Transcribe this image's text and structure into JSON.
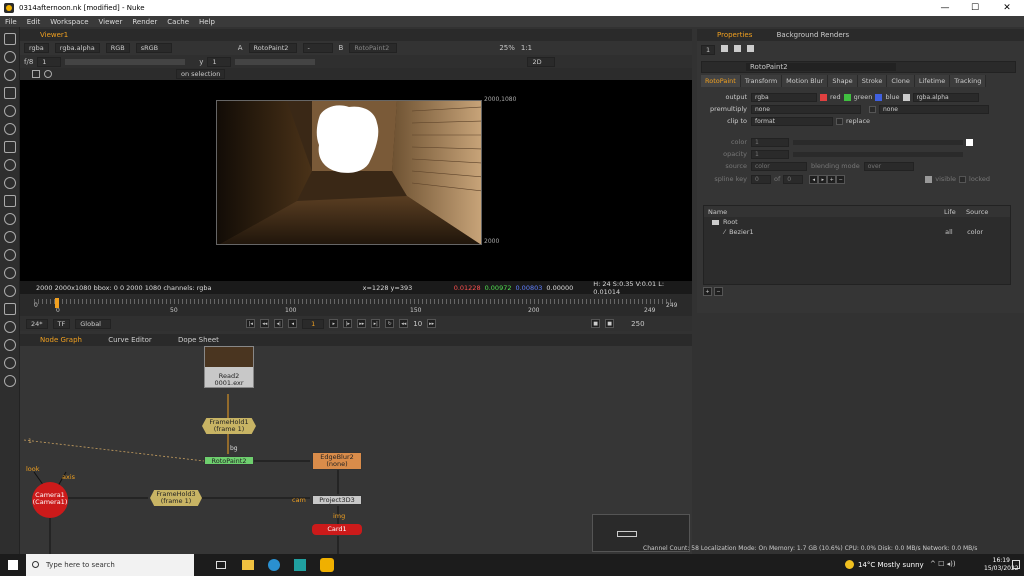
{
  "window": {
    "title": "0314afternoon.nk [modified] - Nuke",
    "controls": [
      "—",
      "☐",
      "✕"
    ]
  },
  "menu": [
    "File",
    "Edit",
    "Workspace",
    "Viewer",
    "Render",
    "Cache",
    "Help"
  ],
  "viewer": {
    "tab": "Viewer1",
    "channels": "rgba",
    "alpha": "rgba.alpha",
    "colorspace": "RGB",
    "lut": "sRGB",
    "input_a_label": "A",
    "input_a": "RotoPaint2",
    "input_b_label": "B",
    "input_b": "RotoPaint2",
    "zoom": "25%",
    "ratio": "1:1",
    "mode": "2D",
    "frame_field": "f/8",
    "gain": "1",
    "gamma_label": "y",
    "gamma": "1",
    "on_selection": "on selection",
    "format_label_tr": "2000,1080",
    "format_label_br": "2000",
    "status_left": "2000 2000x1080  bbox: 0 0 2000 1080 channels: rgba",
    "cursor": "x=1228 y=393",
    "r": "0.01228",
    "g": "0.00972",
    "b": "0.00803",
    "a": "0.00000",
    "hsv": "H: 24 S:0.35 V:0.01  L: 0.01014"
  },
  "timeline": {
    "ticks": [
      "0",
      "50",
      "100",
      "150",
      "200",
      "249"
    ],
    "start": "0",
    "end": "249",
    "fps": "24*",
    "tf": "TF",
    "global": "Global",
    "current_frame": "1",
    "increment": "10",
    "end_frame": "250"
  },
  "nodegraph": {
    "tabs": [
      "Node Graph",
      "Curve Editor",
      "Dope Sheet"
    ],
    "nodes": {
      "read2": {
        "name": "Read2",
        "file": "0001.exr"
      },
      "framehold1": {
        "name": "FrameHold1",
        "sub": "(frame 1)"
      },
      "rotopaint2": {
        "name": "RotoPaint2"
      },
      "edgeblur2": {
        "name": "EdgeBlur2",
        "sub": "(none)"
      },
      "camera1": {
        "name": "Camera1",
        "sub": "(Camera1)"
      },
      "framehold3": {
        "name": "FrameHold3",
        "sub": "(frame 1)"
      },
      "project3d3": {
        "name": "Project3D3"
      },
      "card1": {
        "name": "Card1"
      }
    },
    "edge_labels": {
      "look": "look",
      "axis": "axis",
      "cam": "cam",
      "img": "img",
      "bg": "bg",
      "one": "1"
    }
  },
  "properties": {
    "tabs": [
      "Properties",
      "Background Renders"
    ],
    "node_name": "RotoPaint2",
    "subtabs": [
      "RotoPaint",
      "Transform",
      "Motion Blur",
      "Shape",
      "Stroke",
      "Clone",
      "Lifetime",
      "Tracking"
    ],
    "output_label": "output",
    "output": "rgba",
    "channels": [
      "red",
      "green",
      "blue",
      "rgba.alpha"
    ],
    "premultiply_label": "premultiply",
    "premultiply": "none",
    "premultiply2": "none",
    "clip_to_label": "clip to",
    "clip_to": "format",
    "replace": "replace",
    "color_label": "color",
    "color": "1",
    "opacity_label": "opacity",
    "opacity": "1",
    "source_label": "source",
    "source": "color",
    "blending_label": "blending mode",
    "blending": "over",
    "spline_key_label": "spline key",
    "spline_key": "0",
    "spline_of": "of",
    "spline_total": "0",
    "visible": "visible",
    "locked": "locked",
    "layer_headers": [
      "Name",
      "Life",
      "Source"
    ],
    "layers": [
      {
        "name": "Root"
      },
      {
        "name": "Bezier1",
        "life": "all",
        "source": "color"
      }
    ],
    "add_btn": "+",
    "remove_btn": "−"
  },
  "status_bar": "Channel Count: 58  Localization Mode: On  Memory: 1.7 GB (10.6%)  CPU: 0.0%  Disk: 0.0 MB/s  Network: 0.0 MB/s",
  "taskbar": {
    "search_placeholder": "Type here to search",
    "weather": "14°C  Mostly sunny",
    "time": "16:19",
    "date": "15/03/2022"
  },
  "colors": {
    "accent": "#f0a020",
    "read_node": "#c8c8c8",
    "framehold_node": "#c8b464",
    "rotopaint_node": "#6ecf6e",
    "edgeblur_node": "#d98c4a",
    "camera_node": "#cc1a1a",
    "card_node": "#cc1a1a"
  }
}
